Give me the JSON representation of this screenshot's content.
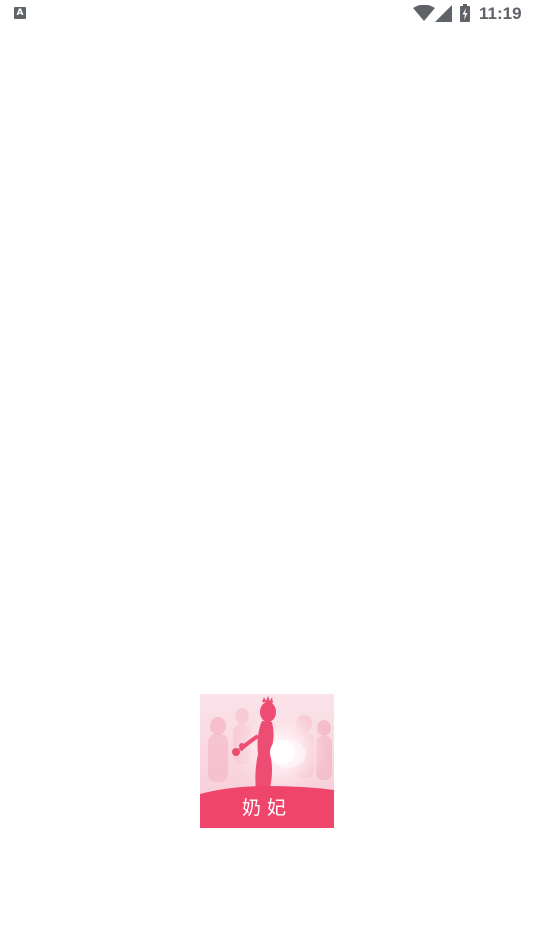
{
  "status_bar": {
    "notification_letter": "A",
    "time": "11:19",
    "icons": [
      "notification-a-icon",
      "wifi-icon",
      "cellular-signal-icon",
      "battery-charging-icon"
    ]
  },
  "splash": {
    "logo_text": "奶妃",
    "logo_icon": "silhouette-woman-crown-icon"
  },
  "colors": {
    "background": "#fefefe",
    "status_icons": "#5f6368",
    "logo_pink": "#f0456b",
    "logo_light_pink": "#f9dde4"
  }
}
